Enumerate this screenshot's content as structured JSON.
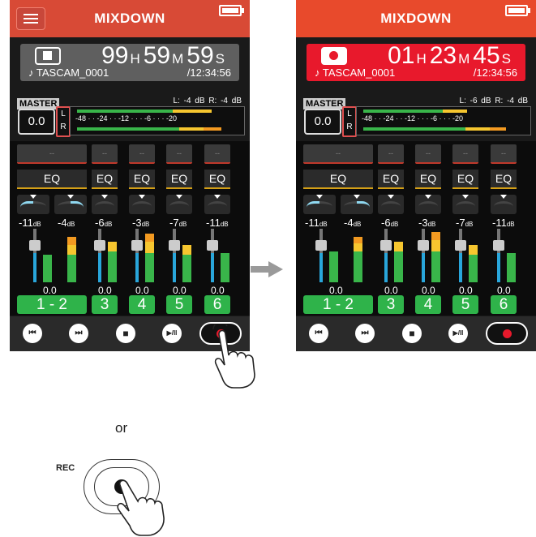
{
  "left_screen": {
    "title": "MIXDOWN",
    "time_h": "99",
    "time_m": "59",
    "time_s": "59",
    "file_name": "♪ TASCAM_0001",
    "total_time": "/12:34:56",
    "master_label": "MASTER",
    "master_value": "0.0",
    "meter_db": "L:  -4 dB  R:  -4 dB",
    "meter_scale": "-48 · · -24 · · -12 · · · -6 · · · -20",
    "eq_label": "EQ",
    "channels": [
      {
        "label": "1  -  2",
        "gain": "-11",
        "gain2": "-4",
        "fader": "0.0"
      },
      {
        "label": "3",
        "gain": "-6",
        "fader": "0.0"
      },
      {
        "label": "4",
        "gain": "-3",
        "fader": "0.0"
      },
      {
        "label": "5",
        "gain": "-7",
        "fader": "0.0"
      },
      {
        "label": "6",
        "gain": "-11",
        "fader": "0.0"
      }
    ],
    "slot_text": "--"
  },
  "right_screen": {
    "title": "MIXDOWN",
    "time_h": "01",
    "time_m": "23",
    "time_s": "45",
    "file_name": "♪ TASCAM_0001",
    "total_time": "/12:34:56",
    "master_label": "MASTER",
    "master_value": "0.0",
    "meter_db": "L:  -6 dB  R:  -4 dB",
    "meter_scale": "-48 · · -24 · · -12 · · · -6 · · · -20",
    "eq_label": "EQ",
    "channels": [
      {
        "label": "1  -  2",
        "gain": "-11",
        "gain2": "-4",
        "fader": "0.0"
      },
      {
        "label": "3",
        "gain": "-6",
        "fader": "0.0"
      },
      {
        "label": "4",
        "gain": "-3",
        "fader": "0.0"
      },
      {
        "label": "5",
        "gain": "-7",
        "fader": "0.0"
      },
      {
        "label": "6",
        "gain": "-11",
        "fader": "0.0"
      }
    ],
    "slot_text": "--"
  },
  "units": {
    "h": "H",
    "m": "M",
    "s": "S",
    "db": "dB"
  },
  "labels": {
    "lr_l": "L",
    "lr_r": "R"
  },
  "transport_icons": [
    "skip-back-icon",
    "skip-forward-icon",
    "stop-icon",
    "play-pause-icon",
    "record-icon"
  ],
  "transport_glyphs": {
    "prev": "⏮",
    "next": "⏭",
    "stop": "■",
    "playpause": "▶/II"
  },
  "or_text": "or",
  "rec_label": "REC",
  "colors": {
    "title_left": "#d84a36",
    "title_right": "#e84a2c",
    "timebox_left": "#5f5f5f",
    "timebox_right": "#e8192c",
    "green": "#2fb34a"
  }
}
